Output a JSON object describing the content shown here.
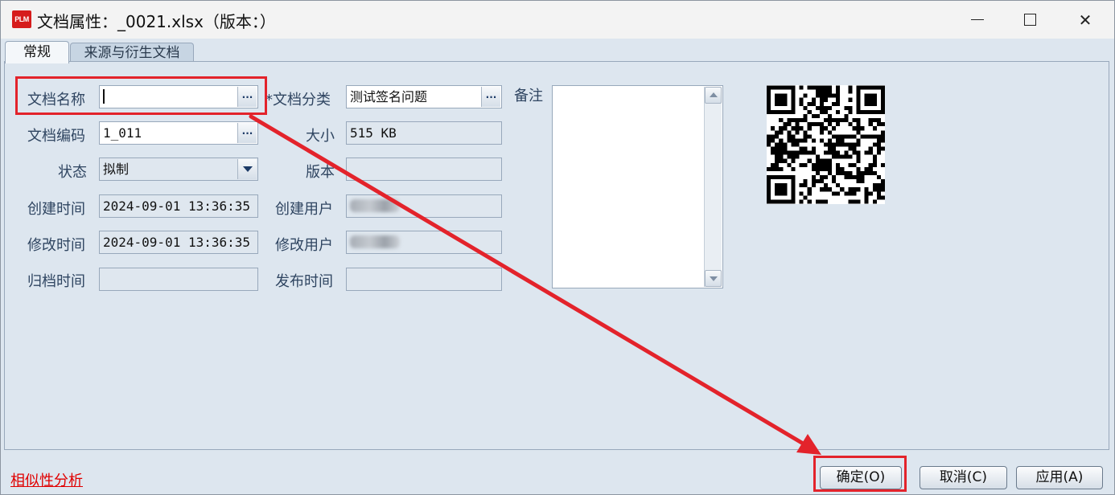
{
  "window": {
    "app_icon_text": "PLM",
    "title": "文档属性：_0021.xlsx（版本：）",
    "minimize_icon": "minimize-icon",
    "maximize_icon": "maximize-icon",
    "close_icon": "close-icon"
  },
  "tabs": [
    {
      "label": "常规",
      "active": true
    },
    {
      "label": "来源与衍生文档",
      "active": false
    }
  ],
  "form": {
    "doc_name": {
      "label": "文档名称",
      "value": ""
    },
    "doc_code": {
      "label": "文档编码",
      "value": "1_011"
    },
    "status": {
      "label": "状态",
      "value": "拟制"
    },
    "created_time": {
      "label": "创建时间",
      "value": "2024-09-01 13:36:35"
    },
    "modified_time": {
      "label": "修改时间",
      "value": "2024-09-01 13:36:35"
    },
    "archived_time": {
      "label": "归档时间",
      "value": ""
    },
    "category": {
      "label": "*文档分类",
      "value": "测试签名问题"
    },
    "size": {
      "label": "大小",
      "value": "515 KB"
    },
    "version": {
      "label": "版本",
      "value": ""
    },
    "created_user": {
      "label": "创建用户",
      "value": ""
    },
    "modified_user": {
      "label": "修改用户",
      "value": ""
    },
    "publish_time": {
      "label": "发布时间",
      "value": ""
    },
    "notes": {
      "label": "备注",
      "value": ""
    },
    "browse_glyph": "...",
    "qr_icon": "qr-code-icon"
  },
  "footer": {
    "similarity_link": "相似性分析",
    "ok_label": "确定(O)",
    "cancel_label": "取消(C)",
    "apply_label": "应用(A)"
  },
  "colors": {
    "annotation_red": "#e3232b",
    "link_red": "#e00000",
    "panel_bg": "#dde6ef"
  }
}
